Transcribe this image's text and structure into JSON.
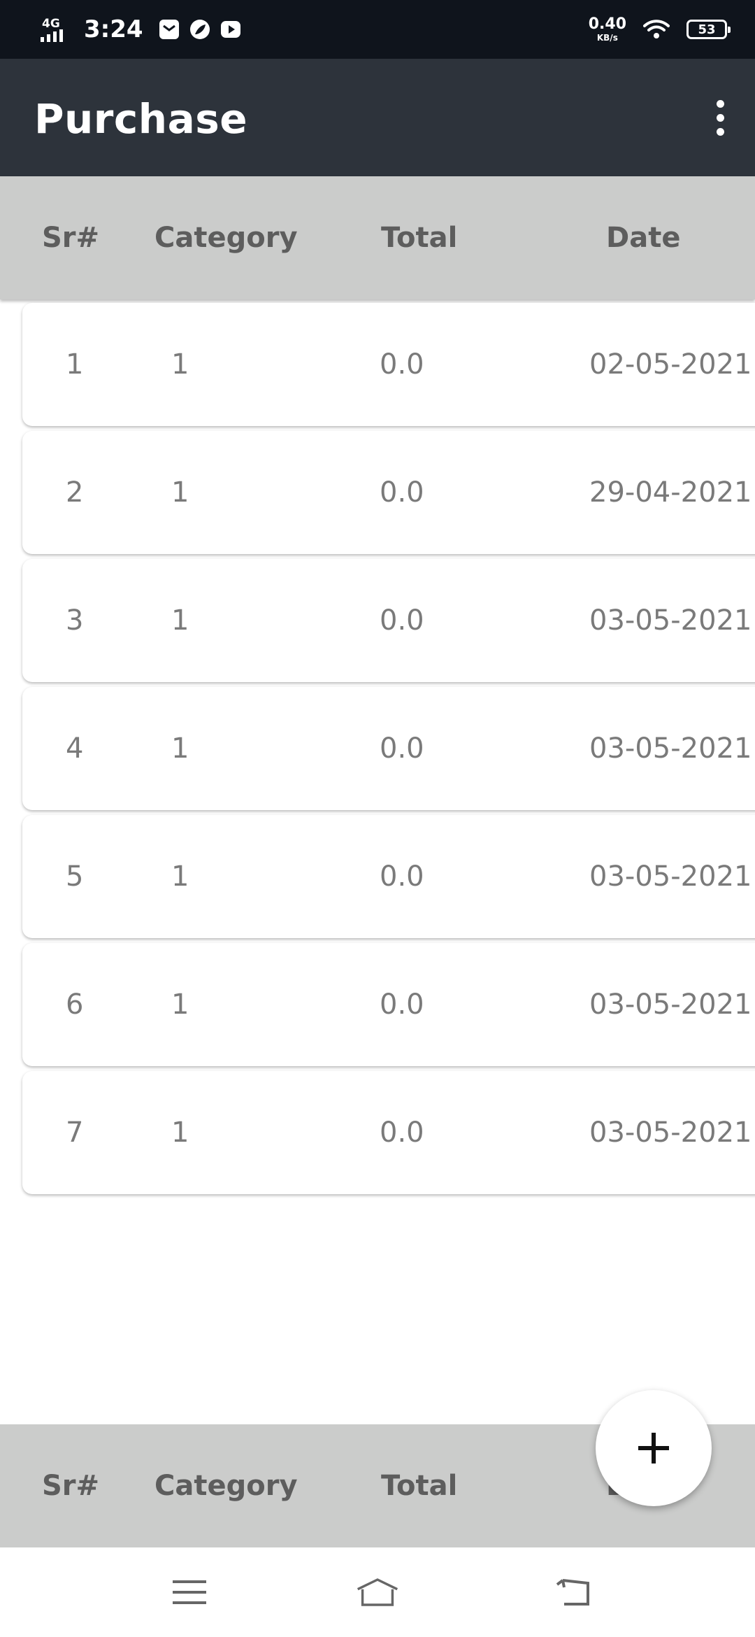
{
  "status_bar": {
    "network": "4G",
    "time": "3:24",
    "speed_value": "0.40",
    "speed_unit": "KB/s",
    "battery": "53",
    "icons": [
      "mail-icon",
      "leaf-icon",
      "youtube-icon",
      "wifi-icon",
      "signal-icon"
    ]
  },
  "app_bar": {
    "title": "Purchase",
    "menu_icon": "more-vert-icon"
  },
  "table": {
    "columns": [
      "Sr#",
      "Category",
      "Total",
      "Date"
    ],
    "rows": [
      {
        "sr": "1",
        "category": "1",
        "total": "0.0",
        "date": "02-05-2021"
      },
      {
        "sr": "2",
        "category": "1",
        "total": "0.0",
        "date": "29-04-2021"
      },
      {
        "sr": "3",
        "category": "1",
        "total": "0.0",
        "date": "03-05-2021"
      },
      {
        "sr": "4",
        "category": "1",
        "total": "0.0",
        "date": "03-05-2021"
      },
      {
        "sr": "5",
        "category": "1",
        "total": "0.0",
        "date": "03-05-2021"
      },
      {
        "sr": "6",
        "category": "1",
        "total": "0.0",
        "date": "03-05-2021"
      },
      {
        "sr": "7",
        "category": "1",
        "total": "0.0",
        "date": "03-05-2021"
      }
    ]
  },
  "footer_header": {
    "columns": [
      "Sr#",
      "Category",
      "Total",
      "D"
    ]
  },
  "fab": {
    "icon": "plus-icon"
  },
  "nav_bar": {
    "icons": [
      "menu-icon",
      "home-icon",
      "back-icon"
    ]
  },
  "colors": {
    "status_bar": "#0f141c",
    "app_bar": "#2d333b",
    "header": "#cbcccb",
    "header_text": "#5d5d5d",
    "row_text": "#7a7a7a"
  }
}
